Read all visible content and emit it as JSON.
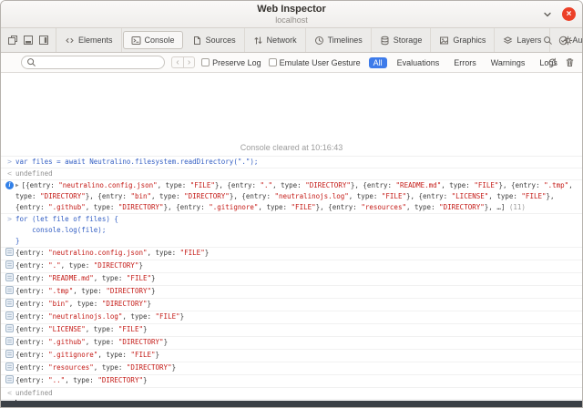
{
  "window": {
    "title": "Web Inspector",
    "subtitle": "localhost",
    "close_glyph": "×"
  },
  "tabbar": {
    "dock_icons": [
      "detach-window-icon",
      "dock-bottom-icon",
      "dock-right-icon"
    ],
    "tabs": [
      {
        "label": "Elements",
        "icon": "elements-icon",
        "selected": false
      },
      {
        "label": "Console",
        "icon": "console-icon",
        "selected": true
      },
      {
        "label": "Sources",
        "icon": "sources-icon",
        "selected": false
      },
      {
        "label": "Network",
        "icon": "network-icon",
        "selected": false
      },
      {
        "label": "Timelines",
        "icon": "timelines-icon",
        "selected": false
      },
      {
        "label": "Storage",
        "icon": "storage-icon",
        "selected": false
      },
      {
        "label": "Graphics",
        "icon": "graphics-icon",
        "selected": false
      },
      {
        "label": "Layers",
        "icon": "layers-icon",
        "selected": false
      },
      {
        "label": "Audit",
        "icon": "audit-icon",
        "selected": false
      }
    ],
    "right_icons": [
      "search-icon",
      "gear-icon"
    ]
  },
  "filterbar": {
    "search": {
      "placeholder": "",
      "value": ""
    },
    "nav_prev": "‹",
    "nav_next": "›",
    "checkboxes": [
      {
        "label": "Preserve Log",
        "checked": false
      },
      {
        "label": "Emulate User Gesture",
        "checked": false
      }
    ],
    "scopes": [
      {
        "label": "All",
        "selected": true
      },
      {
        "label": "Evaluations",
        "selected": false
      },
      {
        "label": "Errors",
        "selected": false
      },
      {
        "label": "Warnings",
        "selected": false
      },
      {
        "label": "Logs",
        "selected": false
      }
    ],
    "right_icons": [
      "reload-icon",
      "trash-icon"
    ]
  },
  "console": {
    "cleared_message": "Console cleared at 10:16:43",
    "entries": [
      {
        "type": "command",
        "text": "var files = await Neutralino.filesystem.readDirectory(\".\");"
      },
      {
        "type": "result",
        "text": "undefined"
      },
      {
        "type": "array-preview",
        "text": "[{entry: \"neutralino.config.json\", type: \"FILE\"}, {entry: \".\", type: \"DIRECTORY\"}, {entry: \"README.md\", type: \"FILE\"}, {entry: \".tmp\", type: \"DIRECTORY\"}, {entry: \"bin\", type: \"DIRECTORY\"}, {entry: \"neutralinojs.log\", type: \"FILE\"}, {entry: \"LICENSE\", type: \"FILE\"}, {entry: \".github\", type: \"DIRECTORY\"}, {entry: \".gitignore\", type: \"FILE\"}, {entry: \"resources\", type: \"DIRECTORY\"}, …]",
        "count": "(11)"
      },
      {
        "type": "command",
        "lines": [
          "for (let file of files) {",
          "    console.log(file);",
          "}"
        ]
      },
      {
        "type": "log",
        "text": "{entry: \"neutralino.config.json\", type: \"FILE\"}"
      },
      {
        "type": "log",
        "text": "{entry: \".\", type: \"DIRECTORY\"}"
      },
      {
        "type": "log",
        "text": "{entry: \"README.md\", type: \"FILE\"}"
      },
      {
        "type": "log",
        "text": "{entry: \".tmp\", type: \"DIRECTORY\"}"
      },
      {
        "type": "log",
        "text": "{entry: \"bin\", type: \"DIRECTORY\"}"
      },
      {
        "type": "log",
        "text": "{entry: \"neutralinojs.log\", type: \"FILE\"}"
      },
      {
        "type": "log",
        "text": "{entry: \"LICENSE\", type: \"FILE\"}"
      },
      {
        "type": "log",
        "text": "{entry: \".github\", type: \"DIRECTORY\"}"
      },
      {
        "type": "log",
        "text": "{entry: \".gitignore\", type: \"FILE\"}"
      },
      {
        "type": "log",
        "text": "{entry: \"resources\", type: \"DIRECTORY\"}"
      },
      {
        "type": "log",
        "text": "{entry: \"..\", type: \"DIRECTORY\"}"
      },
      {
        "type": "result",
        "text": "undefined"
      },
      {
        "type": "prompt"
      }
    ]
  },
  "colors": {
    "accent_blue": "#3d7bea",
    "command_blue": "#3560c4",
    "string_red": "#c41a16",
    "close_red": "#ec4028",
    "bottom_strip": "#3b4046"
  }
}
